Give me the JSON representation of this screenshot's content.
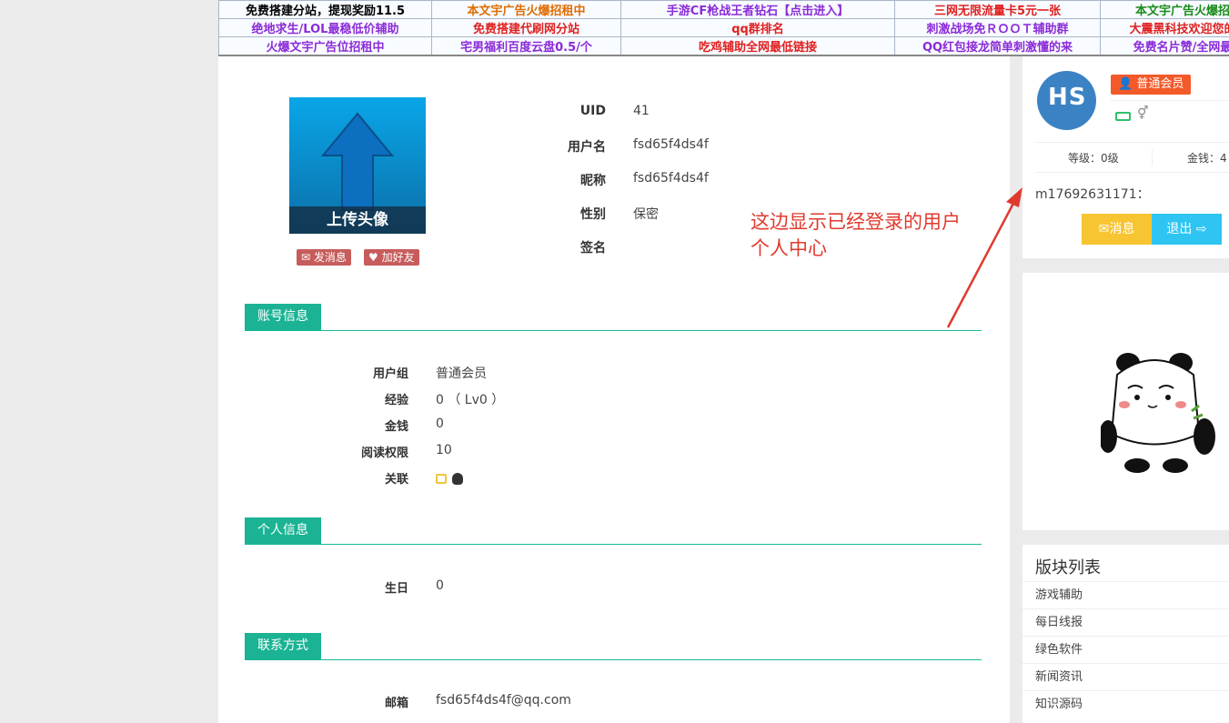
{
  "ad_bar": {
    "rows": [
      [
        {
          "text": "免费搭建分站，提现奖励11.5",
          "color": "#000000"
        },
        {
          "text": "本文宇广告火爆招租中",
          "color": "#e06b00"
        },
        {
          "text": "手游CF枪战王者钻石【点击进入】",
          "color": "#8b2bd8"
        },
        {
          "text": "三网无限流量卡5元一张",
          "color": "#e02020"
        },
        {
          "text": "本文宇广告火爆招",
          "color": "#1a8a1a"
        }
      ],
      [
        {
          "text": "绝地求生/LOL最稳低价辅助",
          "color": "#8b2bd8"
        },
        {
          "text": "免费搭建代刷网分站",
          "color": "#e02020"
        },
        {
          "text": "qq群排名",
          "color": "#e02020"
        },
        {
          "text": "刺激战场免ＲＯＯＴ辅助群",
          "color": "#8b2bd8"
        },
        {
          "text": "大震黑科技欢迎您的",
          "color": "#e02020"
        }
      ],
      [
        {
          "text": "火爆文宇广告位招租中",
          "color": "#8b2bd8"
        },
        {
          "text": "宅男福利百度云盘0.5/个",
          "color": "#8b2bd8"
        },
        {
          "text": "吃鸡辅助全网最低链接",
          "color": "#e02020"
        },
        {
          "text": "QQ红包接龙简单刺激懂的来",
          "color": "#8b2bd8"
        },
        {
          "text": "免费名片赞/全网最",
          "color": "#8b2bd8"
        }
      ]
    ]
  },
  "profile": {
    "avatar_caption": "上传头像",
    "send_message": "发消息",
    "add_friend": "加好友",
    "fields": [
      {
        "label": "UID",
        "value": "41"
      },
      {
        "label": "用户名",
        "value": "fsd65f4ds4f"
      },
      {
        "label": "昵称",
        "value": "fsd65f4ds4f"
      },
      {
        "label": "性别",
        "value": "保密"
      },
      {
        "label": "签名",
        "value": ""
      }
    ]
  },
  "annotation": "这边显示已经登录的用户个人中心",
  "sections": {
    "account": {
      "title": "账号信息",
      "rows": [
        {
          "k": "用户组",
          "v": "普通会员"
        },
        {
          "k": "经验",
          "v": "0 （ Lv0 ）"
        },
        {
          "k": "金钱",
          "v": "0"
        },
        {
          "k": "阅读权限",
          "v": "10"
        },
        {
          "k": "关联",
          "v": ""
        }
      ]
    },
    "personal": {
      "title": "个人信息",
      "rows": [
        {
          "k": "生日",
          "v": "0"
        }
      ]
    },
    "contact": {
      "title": "联系方式",
      "rows": [
        {
          "k": "邮箱",
          "v": "fsd65f4ds4f@qq.com"
        }
      ]
    }
  },
  "sidebar": {
    "avatar_letters": "HS",
    "member_badge": "普通会员",
    "level": "等级：0级",
    "money": "金钱：4",
    "username_line": "m17692631171：",
    "message_button": "消息",
    "logout_button": "退出",
    "forum_title": "版块列表",
    "forums": [
      "游戏辅助",
      "每日线报",
      "绿色软件",
      "新闻资讯",
      "知识源码"
    ]
  },
  "colors": {
    "accent": "#1bb394",
    "badge": "#f25a2a",
    "annotation": "#e03a2e",
    "msg_btn": "#f7c531",
    "logout_btn": "#2ec5f2"
  }
}
